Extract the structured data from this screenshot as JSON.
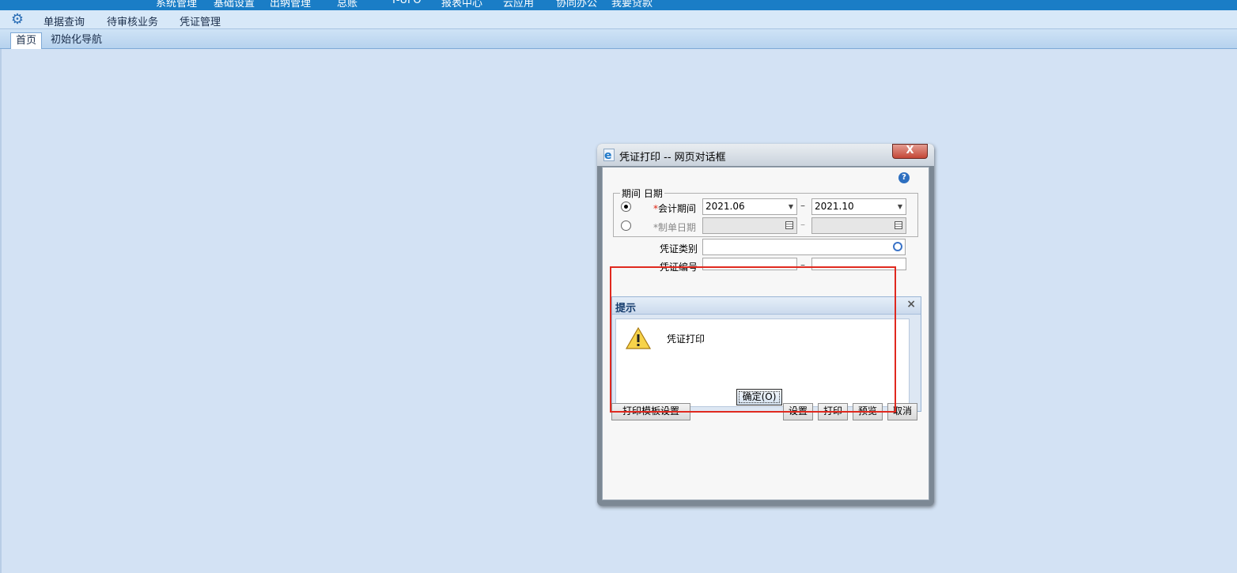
{
  "topbar": {
    "items": [
      "系统管理",
      "基础设置",
      "出纳管理",
      "总账",
      "T-UFO",
      "报表中心",
      "云应用",
      "协同办公",
      "我要贷款"
    ]
  },
  "menubar": {
    "icon": "gear-icon",
    "items": [
      "单据查询",
      "待审核业务",
      "凭证管理"
    ]
  },
  "tabs": [
    "首页",
    "初始化导航"
  ],
  "dialog": {
    "title": "凭证打印 -- 网页对话框",
    "close": "X",
    "group_legend": "期间 日期",
    "radio1_label": "会计期间",
    "period_from": "2021.06",
    "period_to": "2021.10",
    "radio2_label": "制单日期",
    "dash": "–",
    "voucher_type_label": "凭证类别",
    "voucher_no_label": "凭证编号",
    "buttons": {
      "template": "打印模板设置",
      "settings": "设置",
      "print": "打印",
      "preview": "预览",
      "cancel": "取消"
    }
  },
  "prompt": {
    "title": "提示",
    "close": "×",
    "message": "凭证打印",
    "ok": "确定(O)"
  },
  "colors": {
    "topbar": "#1a7dc6",
    "background": "#d3e2f4",
    "highlight": "#e0291f"
  }
}
